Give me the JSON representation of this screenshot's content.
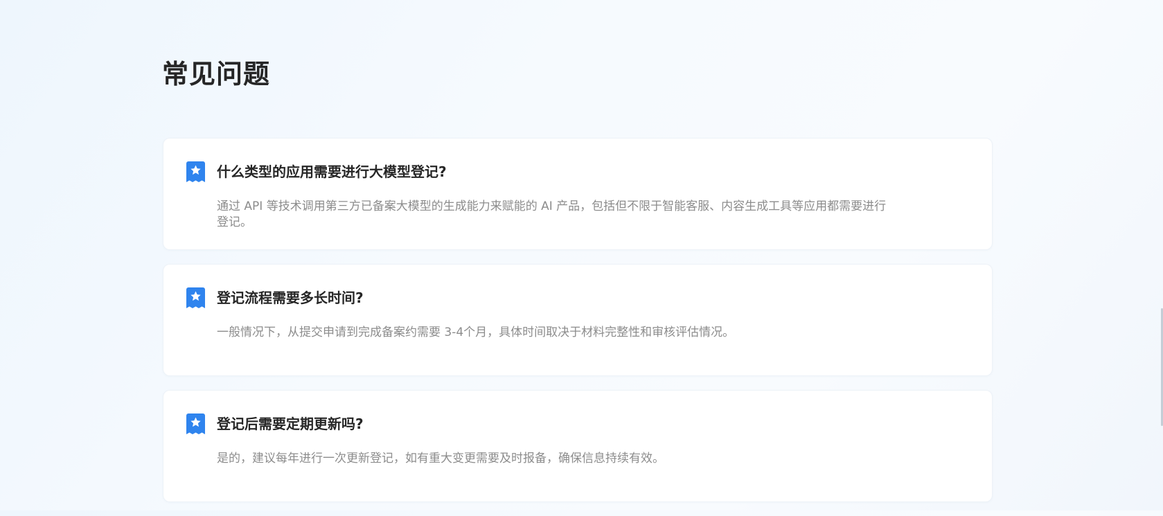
{
  "page": {
    "title": "常见问题"
  },
  "faq": {
    "items": [
      {
        "question": "什么类型的应用需要进行大模型登记?",
        "answer": "通过 API 等技术调用第三方已备案大模型的生成能力来赋能的 AI 产品，包括但不限于智能客服、内容生成工具等应用都需要进行登记。"
      },
      {
        "question": "登记流程需要多长时间?",
        "answer": "一般情况下，从提交申请到完成备案约需要 3-4个月，具体时间取决于材料完整性和审核评估情况。"
      },
      {
        "question": "登记后需要定期更新吗?",
        "answer": "是的，建议每年进行一次更新登记，如有重大变更需要及时报备，确保信息持续有效。"
      }
    ],
    "icon": "bookmark-star-icon"
  },
  "colors": {
    "accent": "#2f84ee",
    "title_text": "#262626",
    "answer_text": "#8c8c8c",
    "card_background": "#ffffff"
  }
}
